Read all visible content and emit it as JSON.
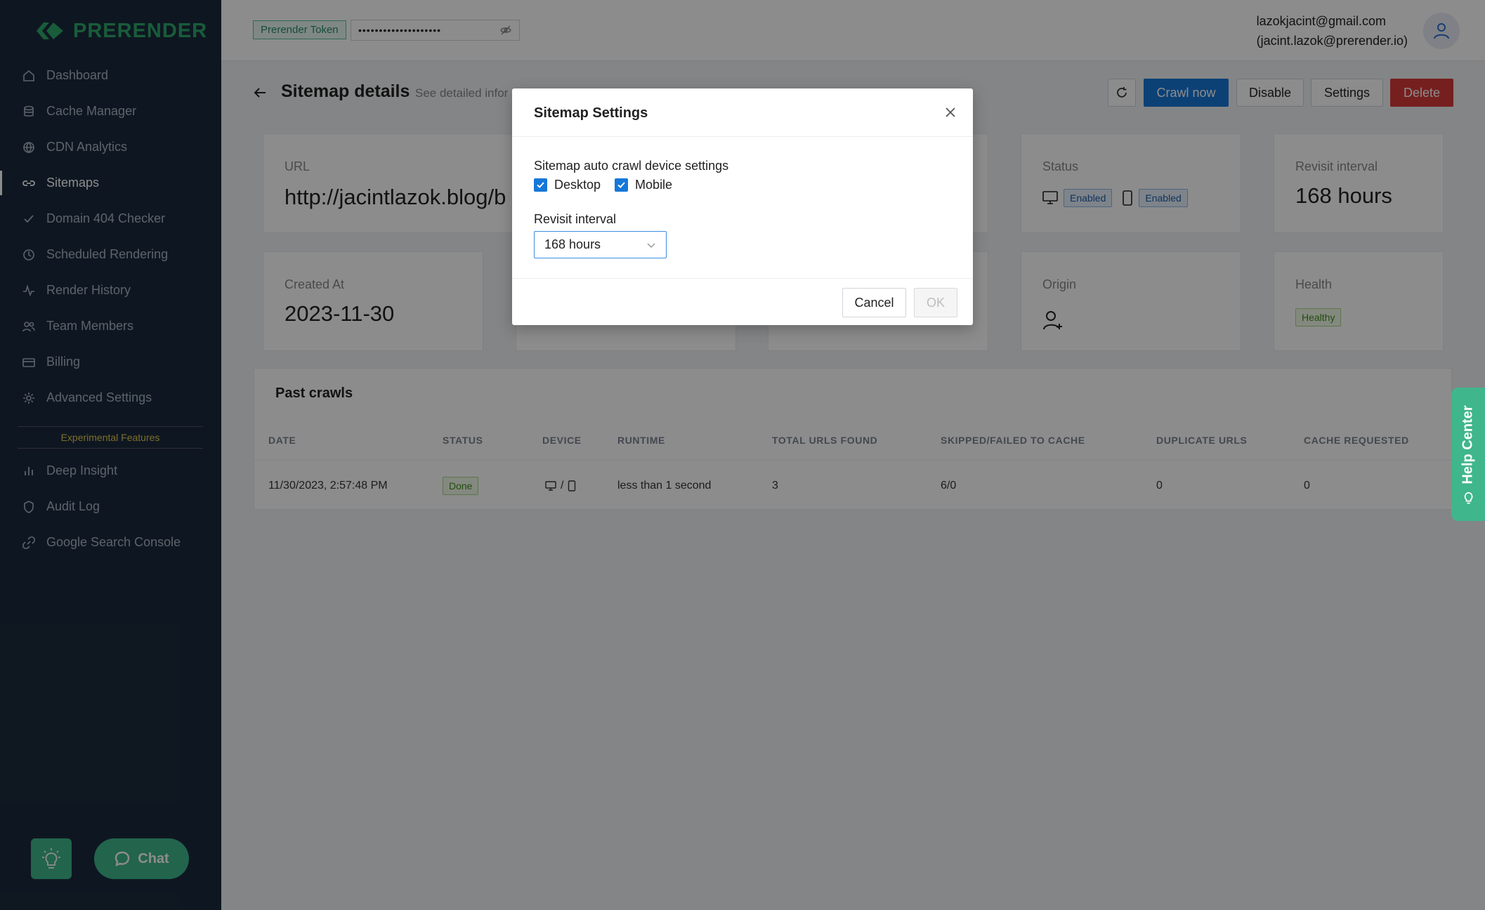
{
  "brand": {
    "name": "PRERENDER"
  },
  "sidebar": {
    "items": [
      {
        "label": "Dashboard",
        "icon": "home-icon"
      },
      {
        "label": "Cache Manager",
        "icon": "database-icon"
      },
      {
        "label": "CDN Analytics",
        "icon": "globe-icon"
      },
      {
        "label": "Sitemaps",
        "icon": "link-icon",
        "active": true
      },
      {
        "label": "Domain 404 Checker",
        "icon": "check-icon"
      },
      {
        "label": "Scheduled Rendering",
        "icon": "clock-icon"
      },
      {
        "label": "Render History",
        "icon": "activity-icon"
      },
      {
        "label": "Team Members",
        "icon": "users-icon"
      },
      {
        "label": "Billing",
        "icon": "credit-card-icon"
      },
      {
        "label": "Advanced Settings",
        "icon": "gear-icon"
      }
    ],
    "experimental_label": "Experimental Features",
    "experimental_items": [
      {
        "label": "Deep Insight",
        "icon": "bar-chart-icon"
      },
      {
        "label": "Audit Log",
        "icon": "shield-icon"
      },
      {
        "label": "Google Search Console",
        "icon": "link-icon"
      }
    ],
    "chat_label": "Chat"
  },
  "topbar": {
    "token_label": "Prerender Token",
    "token_value": "••••••••••••••••••••",
    "user_email": "lazokjacint@gmail.com",
    "user_alt_email": "(jacint.lazok@prerender.io)"
  },
  "header": {
    "title": "Sitemap details",
    "subtitle": "See detailed infor",
    "buttons": {
      "crawl": "Crawl now",
      "disable": "Disable",
      "settings": "Settings",
      "delete": "Delete"
    }
  },
  "cards": {
    "url": {
      "label": "URL",
      "value": "http://jacintlazok.blog/b"
    },
    "status": {
      "label": "Status",
      "desktop": "Enabled",
      "mobile": "Enabled"
    },
    "revisit": {
      "label": "Revisit interval",
      "value": "168 hours"
    },
    "created": {
      "label": "Created At",
      "value": "2023-11-30"
    },
    "origin": {
      "label": "Origin"
    },
    "health": {
      "label": "Health",
      "value": "Healthy"
    }
  },
  "past_crawls": {
    "title": "Past crawls",
    "columns": [
      "DATE",
      "STATUS",
      "DEVICE",
      "RUNTIME",
      "TOTAL URLS FOUND",
      "SKIPPED/FAILED TO CACHE",
      "DUPLICATE URLS",
      "CACHE REQUESTED"
    ],
    "rows": [
      {
        "date": "11/30/2023, 2:57:48 PM",
        "status": "Done",
        "device_sep": "/",
        "runtime": "less than 1 second",
        "total": "3",
        "skipped": "6/0",
        "duplicate": "0",
        "cache_requested": "0"
      }
    ]
  },
  "help_center": {
    "label": "Help Center"
  },
  "modal": {
    "title": "Sitemap Settings",
    "device_label": "Sitemap auto crawl device settings",
    "desktop_label": "Desktop",
    "mobile_label": "Mobile",
    "desktop_checked": true,
    "mobile_checked": true,
    "revisit_label": "Revisit interval",
    "revisit_value": "168 hours",
    "cancel_label": "Cancel",
    "ok_label": "OK"
  },
  "colors": {
    "sidebar_bg": "#1b2a3d",
    "brand_green": "#2ea86a",
    "primary_blue": "#1677d8",
    "danger_red": "#d73a3a",
    "help_green": "#3fb68b"
  }
}
